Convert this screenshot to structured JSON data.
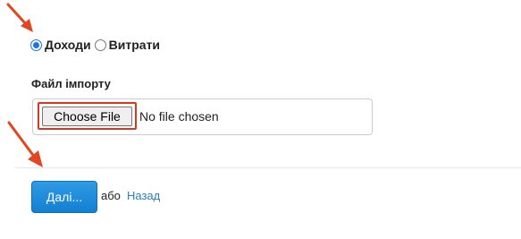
{
  "radio_group": {
    "options": [
      {
        "label": "Доходи",
        "checked": true
      },
      {
        "label": "Витрати",
        "checked": false
      }
    ]
  },
  "import": {
    "label": "Файл імпорту",
    "choose_button": "Choose File",
    "status": "No file chosen"
  },
  "actions": {
    "next_label": "Далі...",
    "or_text": "або",
    "back_label": "Назад"
  },
  "colors": {
    "accent": "#1a73e8",
    "primary_button": "#1f8ad9",
    "link": "#2a7fc2",
    "annotation": "#e2451f"
  }
}
